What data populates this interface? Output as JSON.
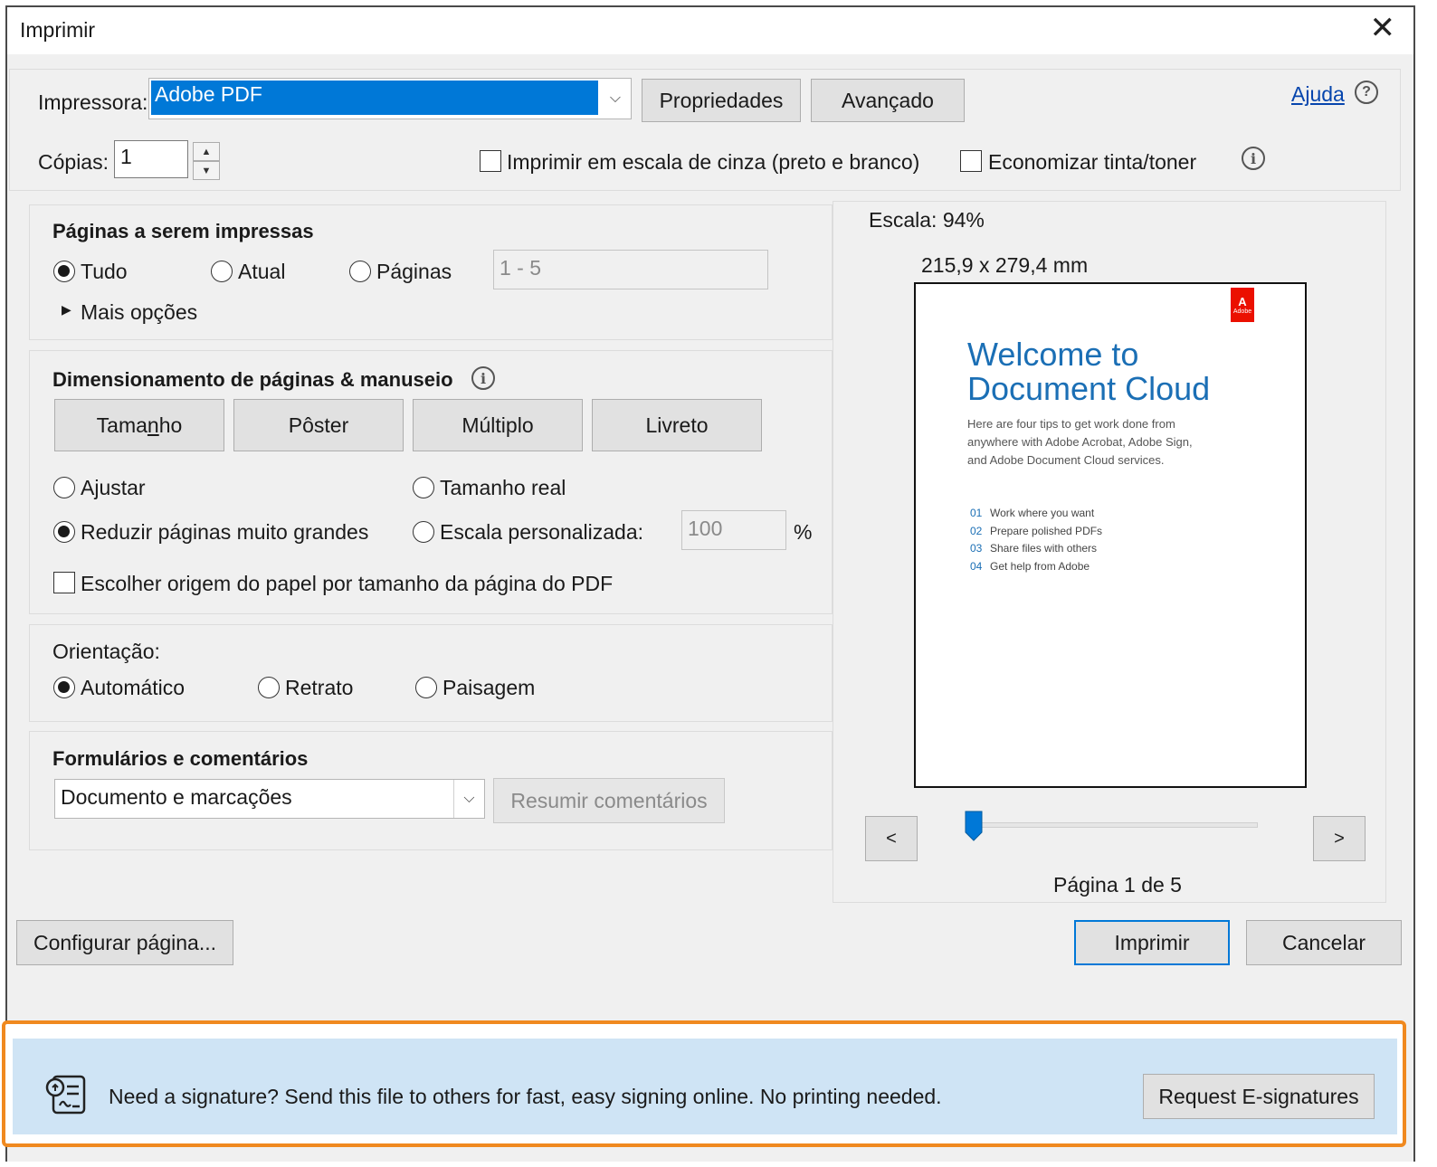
{
  "dialog": {
    "title": "Imprimir"
  },
  "printer": {
    "label": "Impressora:",
    "selected": "Adobe PDF",
    "properties_btn": "Propriedades",
    "advanced_btn": "Avançado",
    "help_link": "Ajuda",
    "copies_label": "Cópias:",
    "copies_value": "1",
    "grayscale_label": "Imprimir em escala de cinza (preto e branco)",
    "save_ink_label": "Economizar tinta/toner"
  },
  "pages": {
    "title": "Páginas a serem impressas",
    "options": [
      "Tudo",
      "Atual",
      "Páginas"
    ],
    "range_value": "1 - 5",
    "more_options": "Mais opções"
  },
  "sizing": {
    "title": "Dimensionamento de páginas & manuseio",
    "tabs": [
      "Tamanho",
      "Pôster",
      "Múltiplo",
      "Livreto"
    ],
    "fit": "Ajustar",
    "actual_size": "Tamanho real",
    "shrink": "Reduzir páginas muito grandes",
    "custom_scale": "Escala personalizada:",
    "custom_scale_value": "100",
    "percent": "%",
    "paper_source": "Escolher origem do papel por tamanho da página do PDF"
  },
  "orientation": {
    "title": "Orientação:",
    "options": [
      "Automático",
      "Retrato",
      "Paisagem"
    ]
  },
  "forms": {
    "title": "Formulários e comentários",
    "selected": "Documento e marcações",
    "summarize_btn": "Resumir comentários"
  },
  "preview": {
    "scale": "Escala:  94%",
    "dimensions": "215,9 x 279,4 mm",
    "prev": "<",
    "next": ">",
    "page_label": "Página 1 de 5",
    "page_fraction": 0.2,
    "doc": {
      "logo_text": "Adobe",
      "heading_line1": "Welcome to",
      "heading_line2": "Document Cloud",
      "intro_lines": [
        "Here are four tips to get work done from",
        "anywhere with Adobe Acrobat, Adobe Sign,",
        "and Adobe Document Cloud services."
      ],
      "tips": [
        {
          "num": "01",
          "text": "Work where you want"
        },
        {
          "num": "02",
          "text": "Prepare polished PDFs"
        },
        {
          "num": "03",
          "text": "Share files with others"
        },
        {
          "num": "04",
          "text": "Get help from Adobe"
        }
      ]
    }
  },
  "footer": {
    "page_setup_btn": "Configurar página...",
    "print_btn": "Imprimir",
    "cancel_btn": "Cancelar"
  },
  "banner": {
    "text": "Need a signature? Send this file to others for fast, easy signing online. No printing needed.",
    "button": "Request E-signatures"
  },
  "colors": {
    "accent": "#0078d7",
    "doc_heading": "#1b6fb5",
    "adobe_red": "#eb1000",
    "banner_bg": "#cfe4f5",
    "highlight_frame": "#f0891f"
  }
}
